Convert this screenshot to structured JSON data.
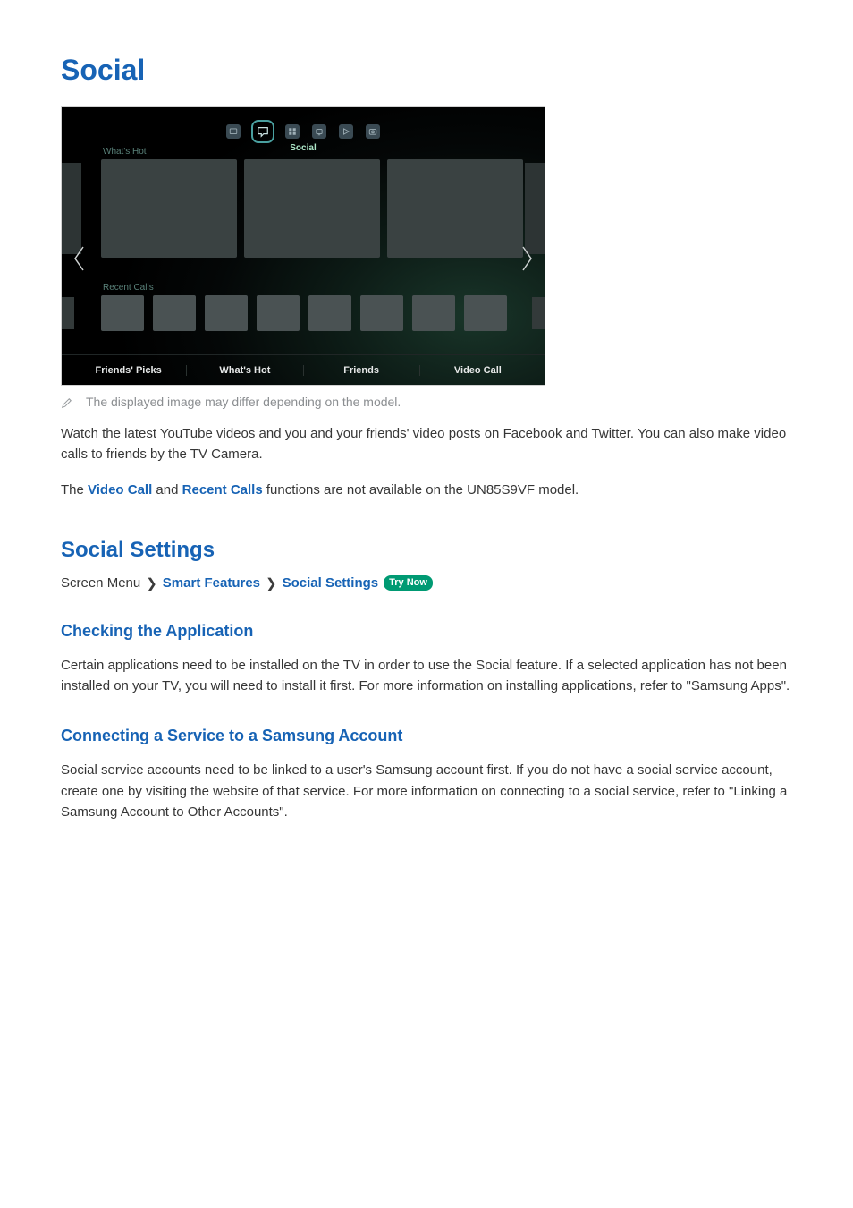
{
  "title": "Social",
  "tv": {
    "nav_active_label": "Social",
    "section_whats_hot": "What's Hot",
    "section_recent": "Recent Calls",
    "bottom": [
      "Friends' Picks",
      "What's Hot",
      "Friends",
      "Video Call"
    ]
  },
  "note": "The displayed image may differ depending on the model.",
  "para1": "Watch the latest YouTube videos and you and your friends' video posts on Facebook and Twitter. You can also make video calls to friends by the TV Camera.",
  "para2_prefix": "The ",
  "para2_link1": "Video Call",
  "para2_mid": " and ",
  "para2_link2": "Recent Calls",
  "para2_suffix": " functions are not available on the UN85S9VF model.",
  "section2": "Social Settings",
  "breadcrumb": {
    "root": "Screen Menu",
    "l1": "Smart Features",
    "l2": "Social Settings",
    "try": "Try Now"
  },
  "sub1": {
    "title": "Checking the Application",
    "body": "Certain applications need to be installed on the TV in order to use the Social feature. If a selected application has not been installed on your TV, you will need to install it first. For more information on installing applications, refer to \"Samsung Apps\"."
  },
  "sub2": {
    "title": "Connecting a Service to a Samsung Account",
    "body": "Social service accounts need to be linked to a user's Samsung account first. If you do not have a social service account, create one by visiting the website of that service. For more information on connecting to a social service, refer to \"Linking a Samsung Account to Other Accounts\"."
  }
}
